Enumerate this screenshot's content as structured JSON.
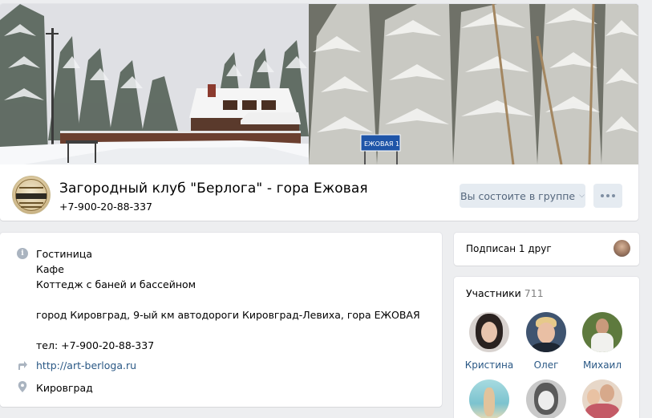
{
  "header": {
    "title": "Загородный клуб \"Берлога\" - гора Ежовая",
    "phone": "+7-900-20-88-337",
    "member_button": "Вы состоите в группе",
    "road_sign": "ЕЖОВАЯ 1"
  },
  "info": {
    "lines": [
      "Гостиница",
      "Кафе",
      "Коттедж с баней и бассейном",
      "",
      "город Кировград, 9-ый км автодороги Кировград-Левиха, гора ЕЖОВАЯ",
      "",
      "тел: +7-900-20-88-337"
    ],
    "website": "http://art-berloga.ru",
    "city": "Кировград"
  },
  "friends": {
    "label": "Подписан 1 друг"
  },
  "members": {
    "title": "Участники",
    "count": "711",
    "people": [
      {
        "name": "Кристина"
      },
      {
        "name": "Олег"
      },
      {
        "name": "Михаил"
      },
      {
        "name": ""
      },
      {
        "name": ""
      },
      {
        "name": ""
      }
    ]
  },
  "colors": {
    "link": "#2a5885",
    "button_bg": "#e5ebf1",
    "button_text": "#55677d",
    "page_bg": "#edeef0"
  },
  "icons": {
    "info": "info-icon",
    "link": "link-arrow-icon",
    "location": "location-pin-icon",
    "more": "more-dots-icon"
  }
}
